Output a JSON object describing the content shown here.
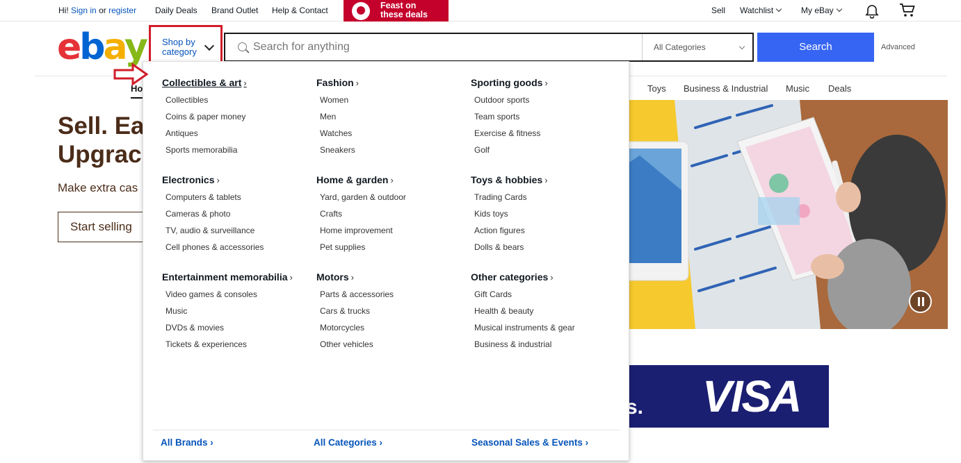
{
  "topbar": {
    "greeting": "Hi!",
    "sign_in": "Sign in",
    "or": "or",
    "register": "register",
    "daily_deals": "Daily Deals",
    "brand_outlet": "Brand Outlet",
    "help_contact": "Help & Contact",
    "promo_line1": "Feast on",
    "promo_line2": "these deals",
    "sell": "Sell",
    "watchlist": "Watchlist",
    "my_ebay": "My eBay"
  },
  "header": {
    "logo": {
      "e": "e",
      "b": "b",
      "a": "a",
      "y": "y"
    },
    "shop_by_category": "Shop by category",
    "search_placeholder": "Search for anything",
    "category_select": "All Categories",
    "search_button": "Search",
    "advanced": "Advanced"
  },
  "nav": {
    "home": "Ho",
    "items": [
      "Toys",
      "Business & Industrial",
      "Music",
      "Deals"
    ]
  },
  "hero": {
    "title_line1": "Sell. Ea",
    "title_line2": "Upgrac",
    "subtitle": "Make extra cas",
    "start_button": "Start selling"
  },
  "visa": {
    "logo": "VISA",
    "fragment": "s."
  },
  "dropdown": {
    "columns": [
      {
        "groups": [
          {
            "title": "Collectibles & art",
            "items": [
              "Collectibles",
              "Coins & paper money",
              "Antiques",
              "Sports memorabilia"
            ]
          },
          {
            "title": "Electronics",
            "items": [
              "Computers & tablets",
              "Cameras & photo",
              "TV, audio & surveillance",
              "Cell phones & accessories"
            ]
          },
          {
            "title": "Entertainment memorabilia",
            "items": [
              "Video games & consoles",
              "Music",
              "DVDs & movies",
              "Tickets & experiences"
            ]
          }
        ]
      },
      {
        "groups": [
          {
            "title": "Fashion",
            "items": [
              "Women",
              "Men",
              "Watches",
              "Sneakers"
            ]
          },
          {
            "title": "Home & garden",
            "items": [
              "Yard, garden & outdoor",
              "Crafts",
              "Home improvement",
              "Pet supplies"
            ]
          },
          {
            "title": "Motors",
            "items": [
              "Parts & accessories",
              "Cars & trucks",
              "Motorcycles",
              "Other vehicles"
            ]
          }
        ]
      },
      {
        "groups": [
          {
            "title": "Sporting goods",
            "items": [
              "Outdoor sports",
              "Team sports",
              "Exercise & fitness",
              "Golf"
            ]
          },
          {
            "title": "Toys & hobbies",
            "items": [
              "Trading Cards",
              "Kids toys",
              "Action figures",
              "Dolls & bears"
            ]
          },
          {
            "title": "Other categories",
            "items": [
              "Gift Cards",
              "Health & beauty",
              "Musical instruments & gear",
              "Business & industrial"
            ]
          }
        ]
      }
    ],
    "footer": [
      "All Brands",
      "All Categories",
      "Seasonal Sales & Events"
    ]
  },
  "colors": {
    "accent_blue": "#3665f3",
    "link_blue": "#0654ba",
    "highlight_red": "#d11d2a",
    "promo_red": "#c4012b",
    "hero_brown": "#4b2c19",
    "visa_navy": "#1a1f71"
  }
}
